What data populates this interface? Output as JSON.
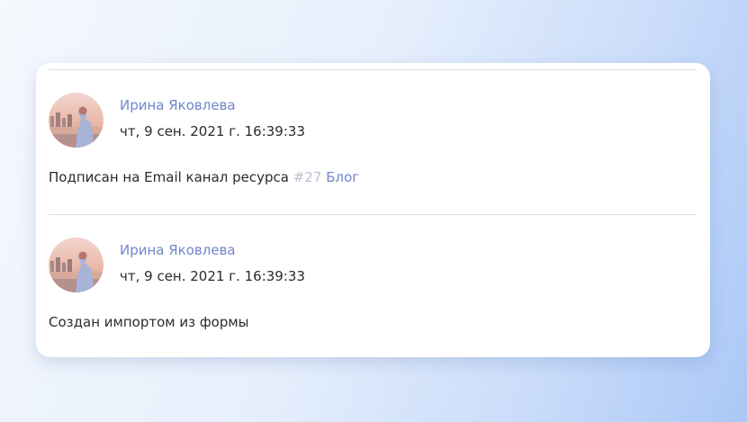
{
  "colors": {
    "author_link": "#6f86c9",
    "resource_number": "#b9c0d0",
    "text": "#2b2b2b",
    "divider": "#dcdcdc"
  },
  "entries": [
    {
      "author": "Ирина Яковлева",
      "datetime": "чт, 9 сен. 2021 г. 16:39:33",
      "message": "Подписан на Email канал ресурса",
      "resource_number": "#27",
      "resource_name": "Блог"
    },
    {
      "author": "Ирина Яковлева",
      "datetime": "чт, 9 сен. 2021 г. 16:39:33",
      "message": "Создан импортом из формы"
    }
  ]
}
